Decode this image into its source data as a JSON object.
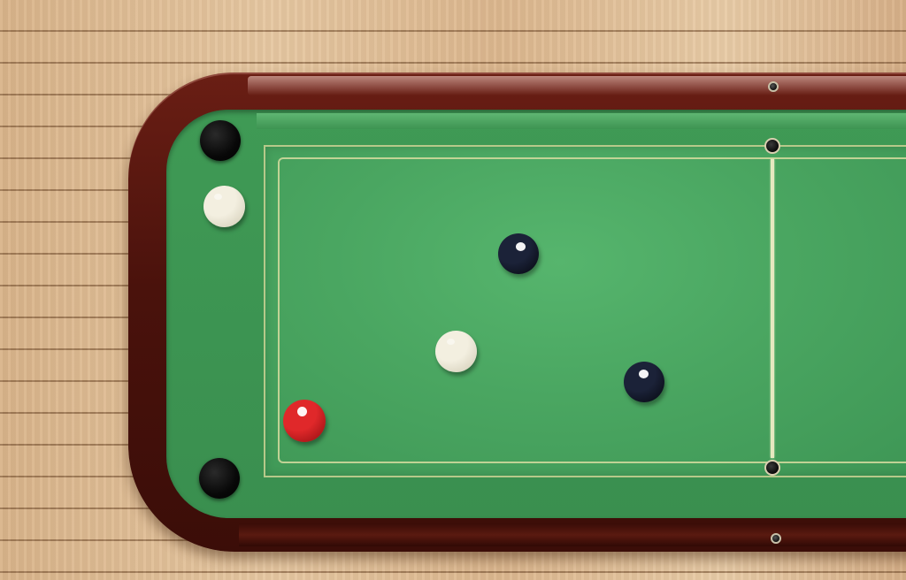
{
  "scene": {
    "type": "snooker-table-top-view",
    "colors": {
      "felt": "#4aa661",
      "cushion": "#3a8f4f",
      "rail": "#4a120c",
      "floor": "#e0bd95",
      "line": "#e6e8c0"
    }
  },
  "balls": [
    {
      "name": "cue-ball-left",
      "color": "#f3efe0",
      "shade": "#cfc9b3"
    },
    {
      "name": "navy-ball-top",
      "color": "#1b2238",
      "shade": "#05070e"
    },
    {
      "name": "cue-ball-center",
      "color": "#f3efe0",
      "shade": "#cfc9b3"
    },
    {
      "name": "navy-ball-right",
      "color": "#1b2238",
      "shade": "#05070e"
    },
    {
      "name": "red-ball",
      "color": "#e0282a",
      "shade": "#8f0d10"
    }
  ],
  "pockets": [
    {
      "name": "pocket-top-left"
    },
    {
      "name": "pocket-bottom-left"
    }
  ]
}
